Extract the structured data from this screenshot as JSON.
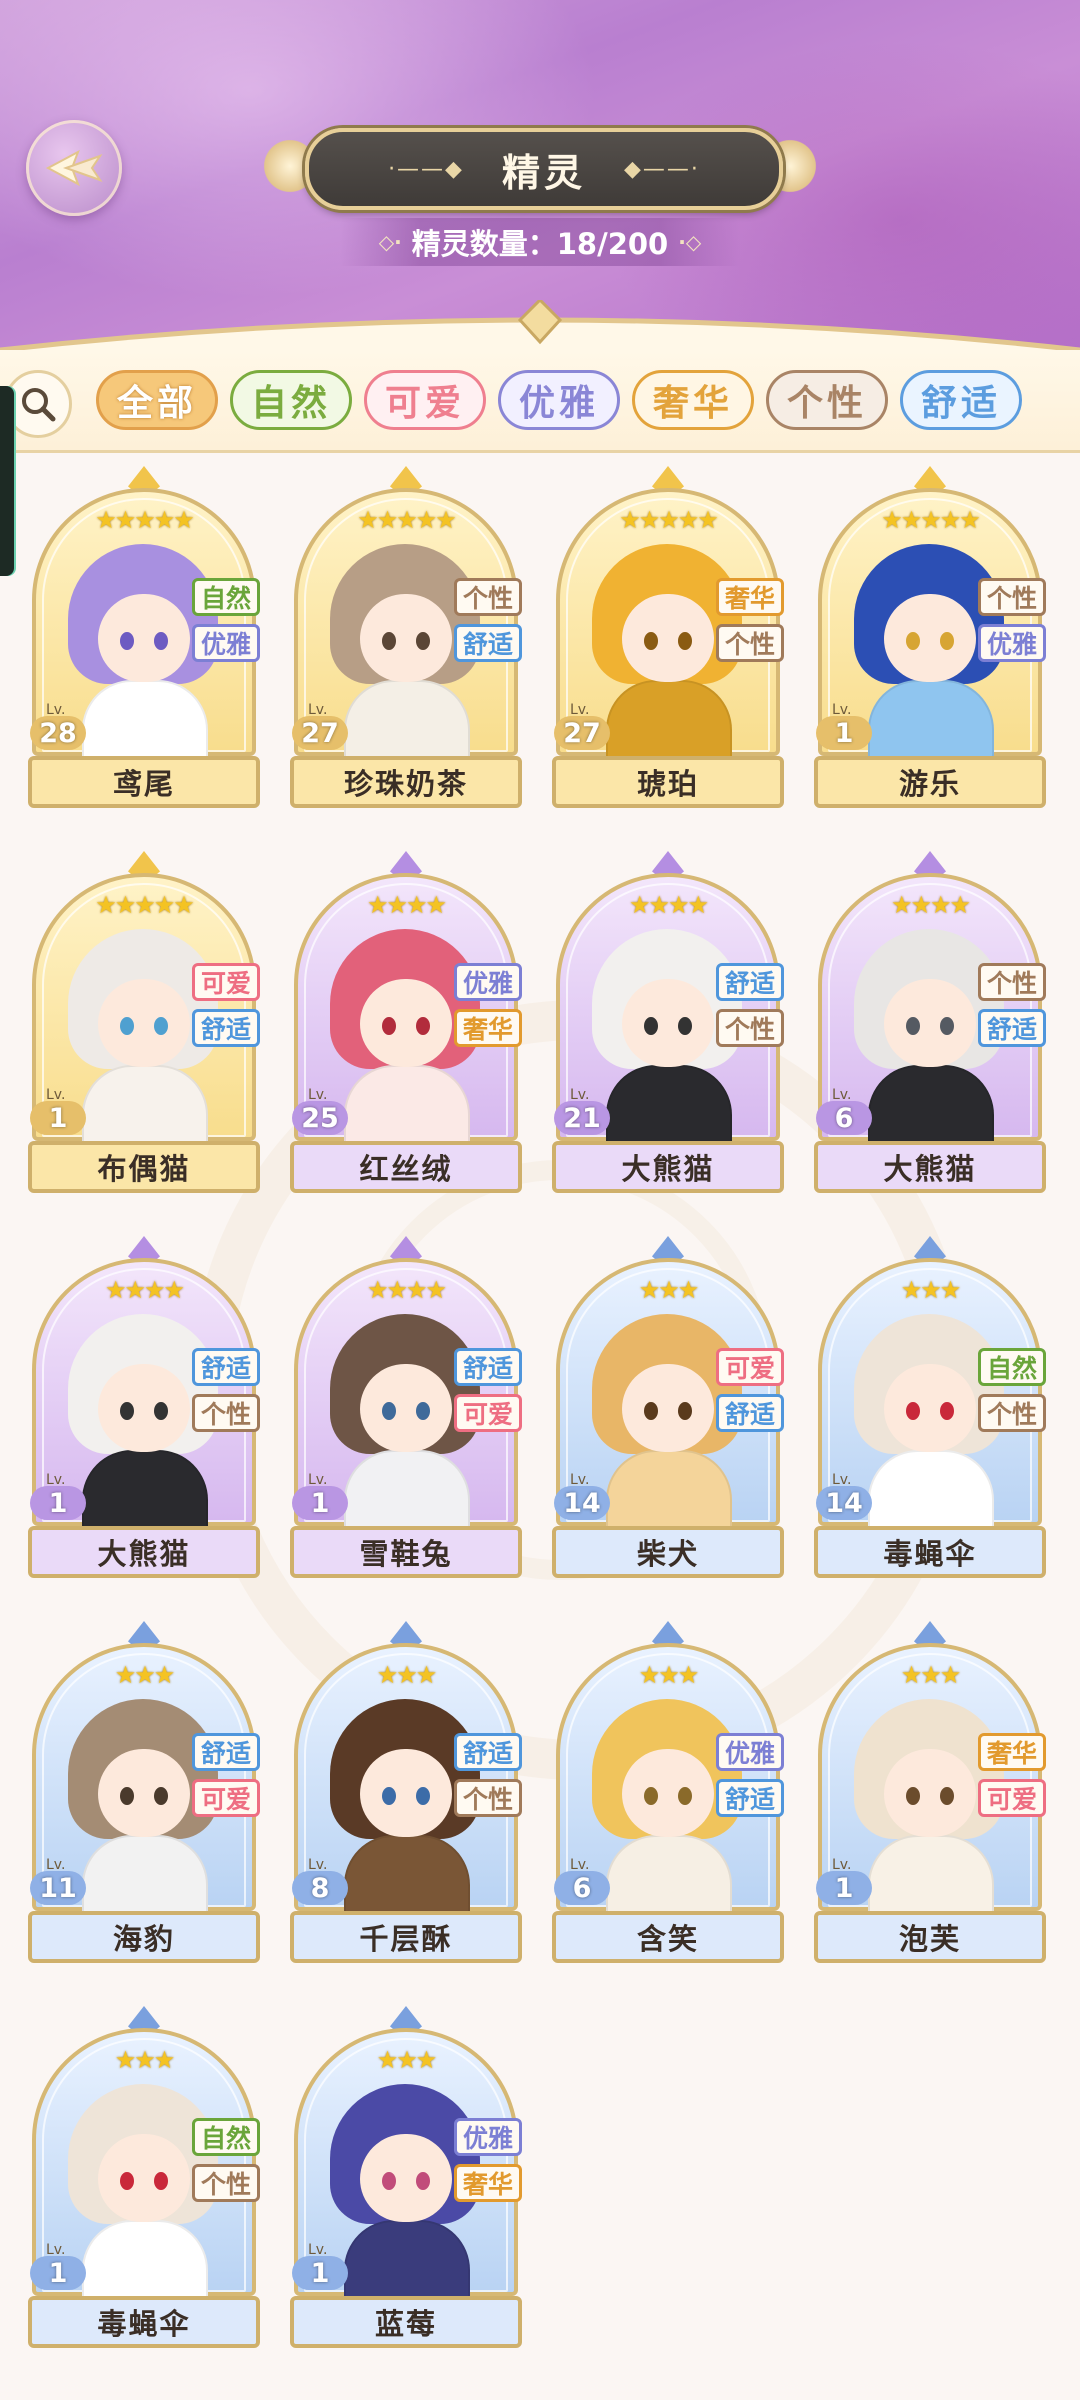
{
  "header": {
    "title": "精灵",
    "count_label": "精灵数量：18/200",
    "title_deco_left": "·——◆",
    "title_deco_right": "◆——·",
    "count_deco_left": "◇·",
    "count_deco_right": "·◇"
  },
  "filters": [
    {
      "label": "全部",
      "selected": true,
      "color": "#e2a04b",
      "bg": "#f6c87a"
    },
    {
      "label": "自然",
      "selected": false,
      "color": "#7bac3f",
      "bg": "#f2f9e4"
    },
    {
      "label": "可爱",
      "selected": false,
      "color": "#ef7f8f",
      "bg": "#fff0f2"
    },
    {
      "label": "优雅",
      "selected": false,
      "color": "#8a86d6",
      "bg": "#f2f0ff"
    },
    {
      "label": "奢华",
      "selected": false,
      "color": "#e3a33b",
      "bg": "#fff6e4"
    },
    {
      "label": "个性",
      "selected": false,
      "color": "#a98466",
      "bg": "#f6ede4"
    },
    {
      "label": "舒适",
      "selected": false,
      "color": "#5c9ddf",
      "bg": "#eaf4ff"
    }
  ],
  "tag_colors": {
    "自然": "#6aa53a",
    "可爱": "#ee6e82",
    "优雅": "#7c7fd4",
    "奢华": "#e29a2e",
    "个性": "#a07a5a",
    "舒适": "#4f96dc"
  },
  "lv_prefix": "Lv.",
  "sprites": [
    {
      "name": "鸢尾",
      "level": "28",
      "stars": 5,
      "rarity": "gold",
      "tags": [
        "自然",
        "优雅"
      ],
      "hair": "#a890e0",
      "outfit": "#ffffff",
      "eye": "#6d5bc2"
    },
    {
      "name": "珍珠奶茶",
      "level": "27",
      "stars": 5,
      "rarity": "gold",
      "tags": [
        "个性",
        "舒适"
      ],
      "hair": "#b79e86",
      "outfit": "#f4efe6",
      "eye": "#5b4636"
    },
    {
      "name": "琥珀",
      "level": "27",
      "stars": 5,
      "rarity": "gold",
      "tags": [
        "奢华",
        "个性"
      ],
      "hair": "#f0b232",
      "outfit": "#d9a027",
      "eye": "#8a5b12"
    },
    {
      "name": "游乐",
      "level": "1",
      "stars": 5,
      "rarity": "gold",
      "tags": [
        "个性",
        "优雅"
      ],
      "hair": "#2c4fb4",
      "outfit": "#8fc5ef",
      "eye": "#d7a533"
    },
    {
      "name": "布偶猫",
      "level": "1",
      "stars": 5,
      "rarity": "gold",
      "tags": [
        "可爱",
        "舒适"
      ],
      "hair": "#eeeae6",
      "outfit": "#f7f2ec",
      "eye": "#4fa0d0"
    },
    {
      "name": "红丝绒",
      "level": "25",
      "stars": 4,
      "rarity": "purple",
      "tags": [
        "优雅",
        "奢华"
      ],
      "hair": "#e2617a",
      "outfit": "#fbe9e6",
      "eye": "#b22c3c"
    },
    {
      "name": "大熊猫",
      "level": "21",
      "stars": 4,
      "rarity": "purple",
      "tags": [
        "舒适",
        "个性"
      ],
      "hair": "#f2f0ee",
      "outfit": "#2a2a2e",
      "eye": "#333333"
    },
    {
      "name": "大熊猫",
      "level": "6",
      "stars": 4,
      "rarity": "purple",
      "tags": [
        "个性",
        "舒适"
      ],
      "hair": "#e8e6e4",
      "outfit": "#2a2a2e",
      "eye": "#555a62"
    },
    {
      "name": "大熊猫",
      "level": "1",
      "stars": 4,
      "rarity": "purple",
      "tags": [
        "舒适",
        "个性"
      ],
      "hair": "#f2f0ee",
      "outfit": "#2a2a2e",
      "eye": "#333333"
    },
    {
      "name": "雪鞋兔",
      "level": "1",
      "stars": 4,
      "rarity": "purple",
      "tags": [
        "舒适",
        "可爱"
      ],
      "hair": "#6e5546",
      "outfit": "#f1f1f3",
      "eye": "#3f6a9a"
    },
    {
      "name": "柴犬",
      "level": "14",
      "stars": 3,
      "rarity": "blue",
      "tags": [
        "可爱",
        "舒适"
      ],
      "hair": "#e8b667",
      "outfit": "#f4d49a",
      "eye": "#5a3a1c"
    },
    {
      "name": "毒蝇伞",
      "level": "14",
      "stars": 3,
      "rarity": "blue",
      "tags": [
        "自然",
        "个性"
      ],
      "hair": "#eee4d8",
      "outfit": "#ffffff",
      "eye": "#c9283a"
    },
    {
      "name": "海豹",
      "level": "11",
      "stars": 3,
      "rarity": "blue",
      "tags": [
        "舒适",
        "可爱"
      ],
      "hair": "#a48c74",
      "outfit": "#f2f2f2",
      "eye": "#4a3a2c"
    },
    {
      "name": "千层酥",
      "level": "8",
      "stars": 3,
      "rarity": "blue",
      "tags": [
        "舒适",
        "个性"
      ],
      "hair": "#5a3a26",
      "outfit": "#7a5636",
      "eye": "#3c6ca8"
    },
    {
      "name": "含笑",
      "level": "6",
      "stars": 3,
      "rarity": "blue",
      "tags": [
        "优雅",
        "舒适"
      ],
      "hair": "#f0c45c",
      "outfit": "#f6efe4",
      "eye": "#8a6a2a"
    },
    {
      "name": "泡芙",
      "level": "1",
      "stars": 3,
      "rarity": "blue",
      "tags": [
        "奢华",
        "可爱"
      ],
      "hair": "#efe2cf",
      "outfit": "#f8f1e6",
      "eye": "#6b4c2c"
    },
    {
      "name": "毒蝇伞",
      "level": "1",
      "stars": 3,
      "rarity": "blue",
      "tags": [
        "自然",
        "个性"
      ],
      "hair": "#eee4d8",
      "outfit": "#ffffff",
      "eye": "#c9283a"
    },
    {
      "name": "蓝莓",
      "level": "1",
      "stars": 3,
      "rarity": "blue",
      "tags": [
        "优雅",
        "奢华"
      ],
      "hair": "#4b4aa6",
      "outfit": "#3a3c7c",
      "eye": "#c14c7a"
    }
  ]
}
